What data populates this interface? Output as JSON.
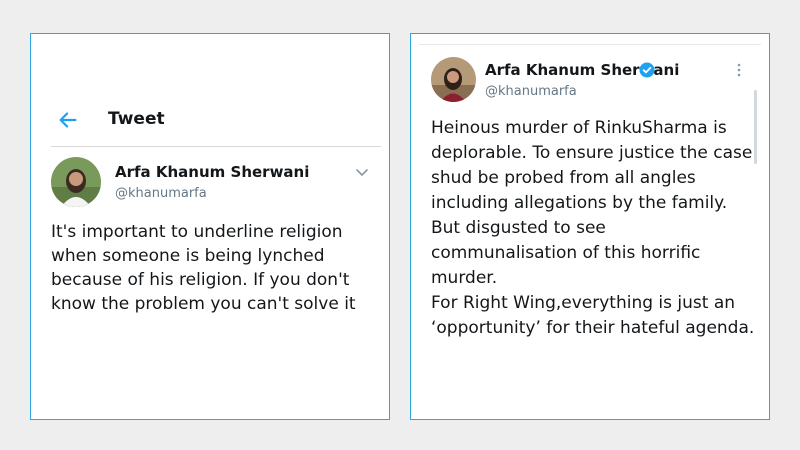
{
  "left_tweet": {
    "header_title": "Tweet",
    "author_name": "Arfa Khanum Sherwani",
    "author_handle": "@khanumarfa",
    "text": "It's important to underline religion when someone is being lynched because of his religion. If you don't know the problem you can't solve it"
  },
  "right_tweet": {
    "author_name": "Arfa Khanum Sherwani",
    "author_handle": "@khanumarfa",
    "paragraphs": [
      "Heinous murder of RinkuSharma is deplorable. To ensure justice the case shud be probed from all angles including allegations by the family.",
      "But disgusted to see communalisation of this horrific murder.",
      "For Right Wing,everything is just an ‘opportunity’ for their hateful agenda."
    ]
  },
  "icons": {
    "back": "arrow-left-icon",
    "expand": "chevron-down-icon",
    "verified": "verified-badge-icon",
    "more": "more-vertical-icon"
  },
  "colors": {
    "accent": "#1da1f2",
    "card_border": "#29a8e0",
    "background": "#eeeeee",
    "secondary_text": "#657786"
  }
}
